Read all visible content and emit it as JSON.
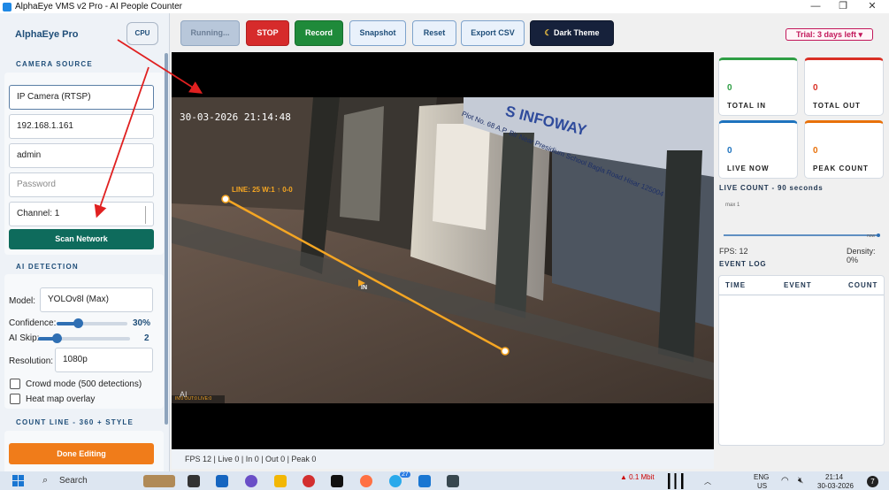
{
  "window": {
    "title": "AlphaEye VMS v2 Pro - AI People Counter",
    "controls": [
      "—",
      "❐",
      "✕"
    ]
  },
  "sidebar": {
    "brand": "AlphaEye Pro",
    "cpu_label": "CPU",
    "camera_source": {
      "title": "CAMERA SOURCE",
      "type_value": "IP Camera (RTSP)",
      "ip_value": "192.168.1.161",
      "user_value": "admin",
      "password_placeholder": "Password",
      "channel_value": "Channel: 1",
      "scan_label": "Scan Network"
    },
    "ai_detection": {
      "title": "AI DETECTION",
      "model_label": "Model:",
      "model_value": "YOLOv8l (Max)",
      "confidence_label": "Confidence:",
      "confidence_value": "30%",
      "confidence_level": 0.3,
      "skip_label": "AI Skip:",
      "skip_value": "2",
      "skip_level": 0.2,
      "resolution_label": "Resolution:",
      "resolution_value": "1080p",
      "crowd_label": "Crowd mode (500 detections)",
      "heatmap_label": "Heat map overlay"
    },
    "count_line": {
      "title": "COUNT LINE - 360 + STYLE",
      "done_label": "Done Editing"
    }
  },
  "toolbar": {
    "running_label": "Running...",
    "stop_label": "STOP",
    "record_label": "Record",
    "snapshot_label": "Snapshot",
    "reset_label": "Reset",
    "export_label": "Export CSV",
    "theme_label": "Dark Theme",
    "theme_icon": "moon-icon",
    "trial_label": "Trial: 3 days left ▾"
  },
  "video": {
    "timestamp": "30-03-2026 21:14:48",
    "sign_text": "S INFOWAY",
    "sign_address": "Plot No. 68 A.P. Bir Near Presidium School Bagla Road Hisar 125004",
    "line_label": "LINE: 25 W:1 ↑ 0-0",
    "in_label": "IN",
    "ai_label": "AI",
    "overlay_small": "IN:0  OUT:0  LIVE:0"
  },
  "status_bar": {
    "text": "FPS 12 | Live 0 | In 0 | Out 0 | Peak 0"
  },
  "stats": {
    "total_in": {
      "value": "0",
      "label": "TOTAL IN",
      "color": "#2e9e44"
    },
    "total_out": {
      "value": "0",
      "label": "TOTAL OUT",
      "color": "#d93025"
    },
    "live_now": {
      "value": "0",
      "label": "LIVE NOW",
      "color": "#1e73be"
    },
    "peak_count": {
      "value": "0",
      "label": "PEAK COUNT",
      "color": "#e8710a"
    }
  },
  "live_count": {
    "title": "LIVE COUNT - 90 seconds",
    "max_label": "max 1",
    "now_label": "now",
    "fps": "FPS: 12",
    "density": "Density: 0%"
  },
  "event_log": {
    "title": "EVENT LOG",
    "columns": [
      "TIME",
      "EVENT",
      "COUNT"
    ]
  },
  "taskbar": {
    "search_label": "Search",
    "net_up": "▲ 0.1 Mbit",
    "lang_line1": "ENG",
    "lang_line2": "US",
    "time": "21:14",
    "date": "30-03-2026",
    "notif_count": "7",
    "weather_badge": "27"
  }
}
